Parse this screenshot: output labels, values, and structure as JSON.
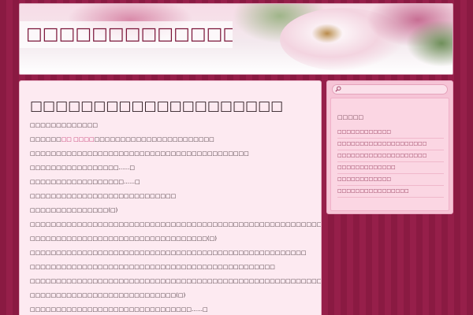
{
  "site": {
    "title": "□□□□□□□□□□□□□□□□□□□□"
  },
  "post": {
    "title": "□□□□□□□□□□□□□□□□□□□□",
    "paragraphs": [
      {
        "text": "□□□□□□□□□□□□□"
      },
      {
        "before": "□□□□□□",
        "link": "□□ □□□□",
        "after": "□□□□□□□□□□□□□□□□□□□□□□□"
      },
      {
        "text": "□□□□□□□□□□□□□□□□□□□□□□□□□□□□□□□□□□□□□□□□□□"
      },
      {
        "text": "□□□□□□□□□□□□□□□□□……□"
      },
      {
        "text": "□□□□□□□□□□□□□□□□□□……□"
      },
      {
        "text": "□□□□□□□□□□□□□□□□□□□□□□□□□□□□"
      },
      {
        "text": "□□□□□□□□□□□□□□□(□)"
      },
      {
        "text": "□□□□□□□□□□□□□□□□□□□□□□□□□□□□□□□□□□□□□□□□□□□□□□□□□□□□□□□□□□□□□□□□□"
      },
      {
        "text": "□□□□□□□□□□□□□□□□□□□□□□□□□□□□□□□□□□(□)"
      },
      {
        "text": "□□□□□□□□□□□□□□□□□□□□□□□□□□□□□□□□□□□□□□□□□□□□□□□□□□□□□"
      },
      {
        "text": "□□□□□□□□□□□□□□□□□□□□□□□□□□□□□□□□□□□□□□□□□□□□□□□"
      },
      {
        "text": "□□□□□□□□□□□□□□□□□□□□□□□□□□□□□□□□□□□□□□□□□□□□□□□□□□□□□□□□□"
      },
      {
        "text": "□□□□□□□□□□□□□□□□□□□□□□□□□□□□(□)"
      },
      {
        "text": "□□□□□□□□□□□□□□□□□□□□□□□□□□□□□□□……□"
      }
    ]
  },
  "sidebar": {
    "search": {
      "placeholder": "",
      "icon": "search-icon"
    },
    "widget": {
      "title": "□□□□□",
      "items": [
        "□□□□□□□□□□□□",
        "□□□□□□□□□□□□□□□□□□□□",
        "□□□□□□□□□□□□□□□□□□□□",
        "□□□□□□□□□□□□□",
        "□□□□□□□□□□□□",
        "□□□□□□□□□□□□□□□□"
      ]
    }
  },
  "colors": {
    "background": "#8d1c44",
    "title_text": "#7a1438",
    "content_bg": "#fdeaf1",
    "sidebar_bg": "#f6c4d6",
    "link": "#c0306a"
  }
}
